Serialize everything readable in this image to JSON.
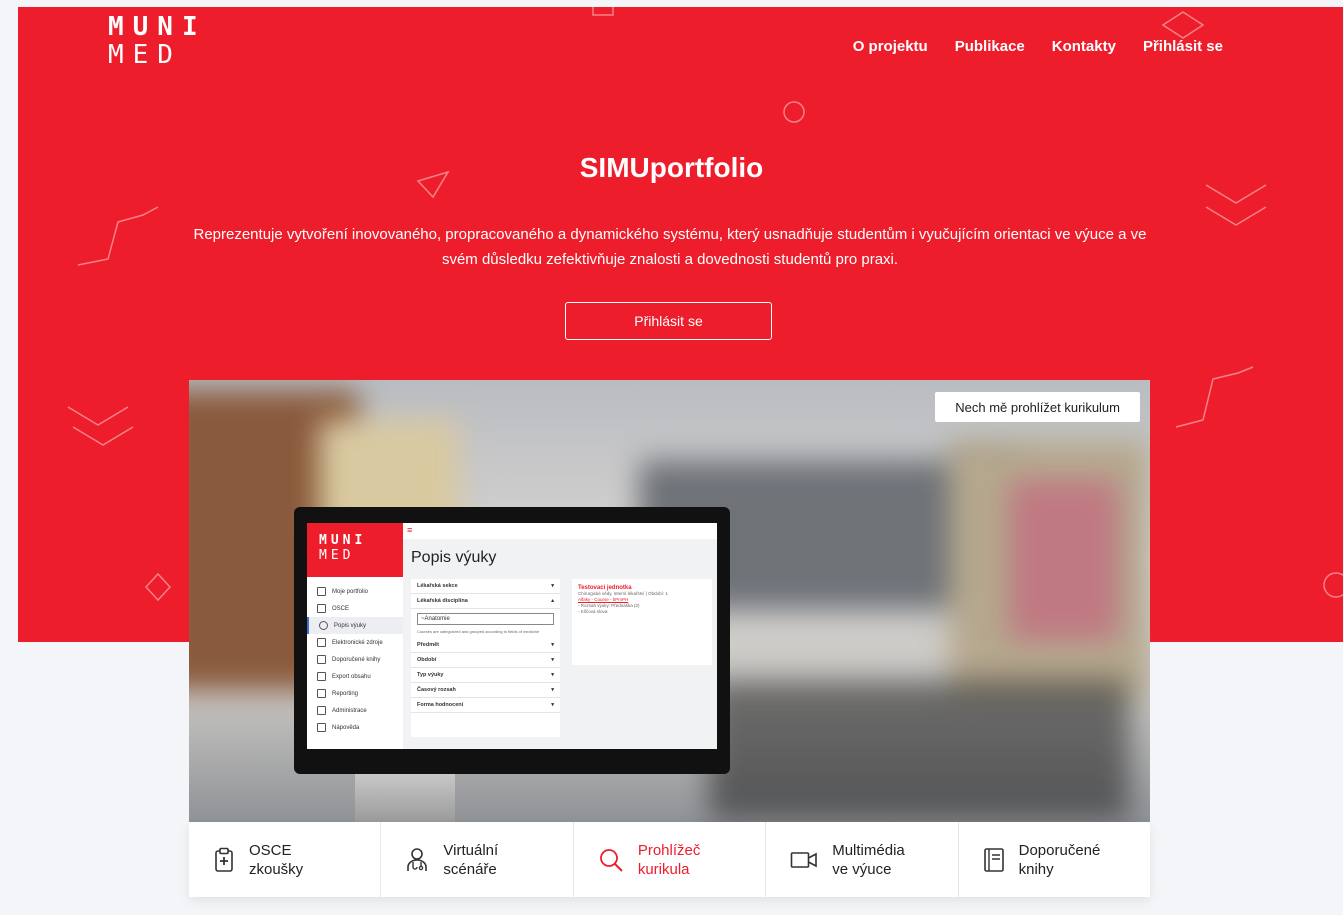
{
  "logo": {
    "line1": "MUNI",
    "line2": "MED"
  },
  "nav": [
    {
      "label": "O projektu"
    },
    {
      "label": "Publikace"
    },
    {
      "label": "Kontakty"
    },
    {
      "label": "Přihlásit se"
    }
  ],
  "hero": {
    "title": "SIMUportfolio",
    "description": "Reprezentuje vytvoření inovovaného, propracovaného a dynamického systému, který usnadňuje studentům i vyučujícím orientaci ve výuce a ve svém důsledku zefektivňuje znalosti a dovednosti studentů pro praxi.",
    "cta": "Přihlásit se"
  },
  "curriculum_button": "Nech mě prohlížet kurikulum",
  "screen": {
    "logo_line1": "MUNI",
    "logo_line2": "MED",
    "title": "Popis výuky",
    "sidebar": [
      "Moje portfolio",
      "OSCE",
      "Popis výuky",
      "Elektronické zdroje",
      "Doporučené knihy",
      "Export obsahu",
      "Reporting",
      "Administrace",
      "Nápověda"
    ],
    "filters_top": [
      "Lékařská sekce",
      "Lékařská disciplína"
    ],
    "input_value": "~Anatomie",
    "note": "Courses are categorized and grouped according to fields of medicine",
    "filters": [
      "Předmět",
      "Období",
      "Typ výuky",
      "Časový rozsah",
      "Forma hodnocení"
    ],
    "card": {
      "title": "Testovací jednotka",
      "line1": "Chirurgické vědy, Interní lékařství | Období: 1",
      "line2": "Alfaky - Course - bPmPH",
      "line3": "- Rozsah výuky: Přednáška (2)",
      "line4": "- Klíčová slova:"
    }
  },
  "tabs": [
    {
      "label": "OSCE\nzkoušky",
      "icon": "clipboard-plus-icon"
    },
    {
      "label": "Virtuální\nscénáře",
      "icon": "doctor-icon"
    },
    {
      "label": "Prohlížeč\nkurikula",
      "icon": "search-icon",
      "active": true
    },
    {
      "label": "Multimédia\nve výuce",
      "icon": "video-camera-icon"
    },
    {
      "label": "Doporučené\nknihy",
      "icon": "book-icon"
    }
  ],
  "colors": {
    "accent": "#ee1d2b",
    "background": "#f3f5f8"
  }
}
